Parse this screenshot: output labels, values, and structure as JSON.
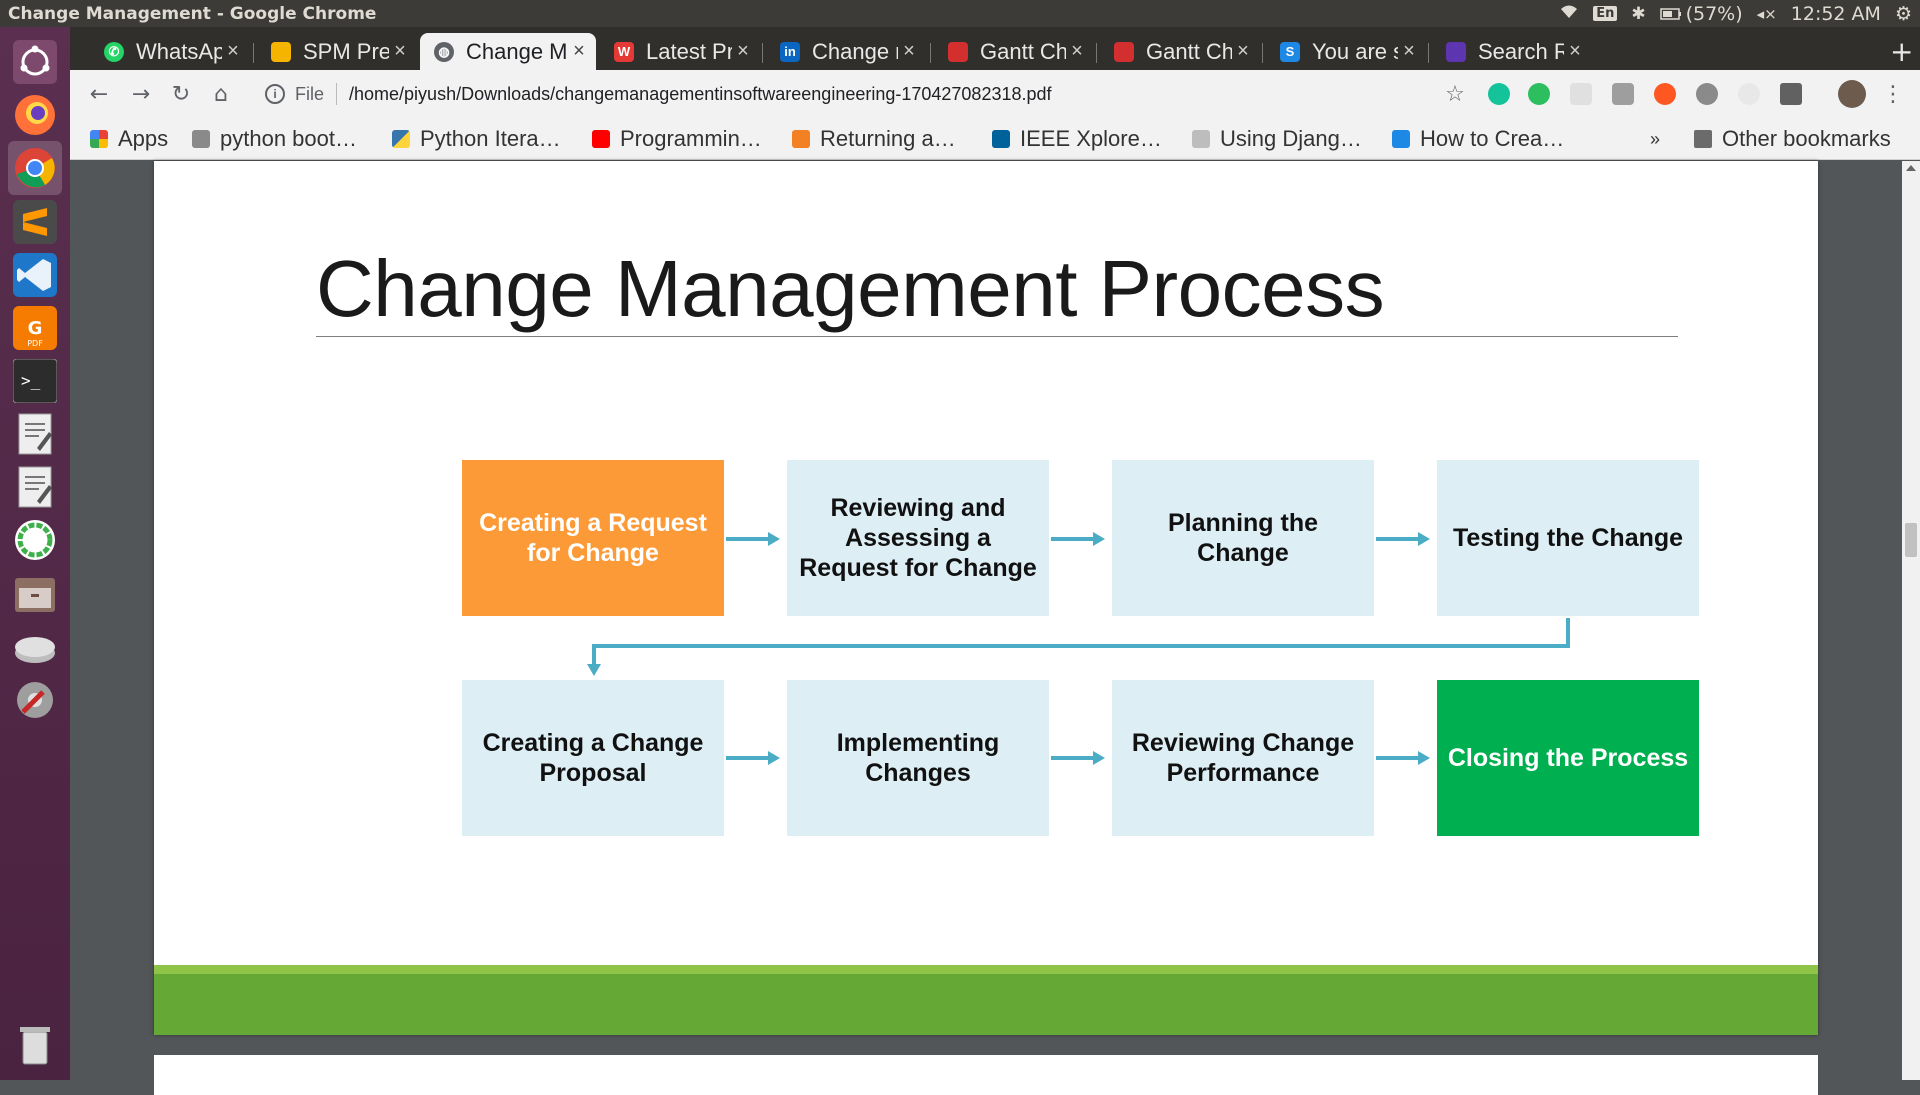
{
  "system": {
    "window_title": "Change Management - Google Chrome",
    "battery": "(57%)",
    "clock": "12:52 AM",
    "keyboard": "En"
  },
  "tabs": [
    {
      "label": "WhatsApp",
      "icon": "whatsapp-icon",
      "color": "#25d366",
      "active": false
    },
    {
      "label": "SPM Prese",
      "icon": "slides-icon",
      "color": "#f4b400",
      "active": false
    },
    {
      "label": "Change Ma",
      "icon": "globe-icon",
      "color": "#5f6368",
      "active": true
    },
    {
      "label": "Latest Proj",
      "icon": "w-icon",
      "color": "#e53935",
      "active": false
    },
    {
      "label": "Change ma",
      "icon": "linkedin-icon",
      "color": "#0a66c2",
      "active": false
    },
    {
      "label": "Gantt Char",
      "icon": "gantt-icon",
      "color": "#d32f2f",
      "active": false
    },
    {
      "label": "Gantt Char",
      "icon": "gantt-icon",
      "color": "#d32f2f",
      "active": false
    },
    {
      "label": "You are sig",
      "icon": "s-icon",
      "color": "#1e88e5",
      "active": false
    },
    {
      "label": "Search Res",
      "icon": "search-result-icon",
      "color": "#5e35b1",
      "active": false
    }
  ],
  "omnibox": {
    "scheme": "File",
    "url": "/home/piyush/Downloads/changemanagementinsoftwareengineering-170427082318.pdf"
  },
  "bookmarks": [
    {
      "label": "Apps",
      "icon": "apps-grid-icon",
      "color": "#4285f4"
    },
    {
      "label": "python boot…",
      "icon": "notebook-icon",
      "color": "#8a8a8a"
    },
    {
      "label": "Python Itera…",
      "icon": "python-icon",
      "color": "#3776ab"
    },
    {
      "label": "Programmin…",
      "icon": "youtube-icon",
      "color": "#ff0000"
    },
    {
      "label": "Returning a…",
      "icon": "stackoverflow-icon",
      "color": "#f48024"
    },
    {
      "label": "IEEE Xplore…",
      "icon": "ieee-icon",
      "color": "#00629b"
    },
    {
      "label": "Using Djang…",
      "icon": "page-icon",
      "color": "#9e9e9e"
    },
    {
      "label": "How to Crea…",
      "icon": "s-icon",
      "color": "#1e88e5"
    }
  ],
  "bookmarks_overflow": "»",
  "other_bookmarks": "Other bookmarks",
  "slide": {
    "title": "Change Management Process",
    "steps": [
      {
        "label": "Creating a Request for Change",
        "style": "orange"
      },
      {
        "label": "Reviewing and Assessing a Request for Change",
        "style": "default"
      },
      {
        "label": "Planning the Change",
        "style": "default"
      },
      {
        "label": "Testing the Change",
        "style": "default"
      },
      {
        "label": "Creating a Change Proposal",
        "style": "default"
      },
      {
        "label": "Implementing Changes",
        "style": "default"
      },
      {
        "label": "Reviewing Change Performance",
        "style": "default"
      },
      {
        "label": "Closing the Process",
        "style": "green"
      }
    ],
    "colors": {
      "orange": "#fd9a38",
      "green": "#00b050",
      "box": "#ddeef5",
      "arrow": "#4bacc6",
      "band": "#66a836"
    }
  }
}
